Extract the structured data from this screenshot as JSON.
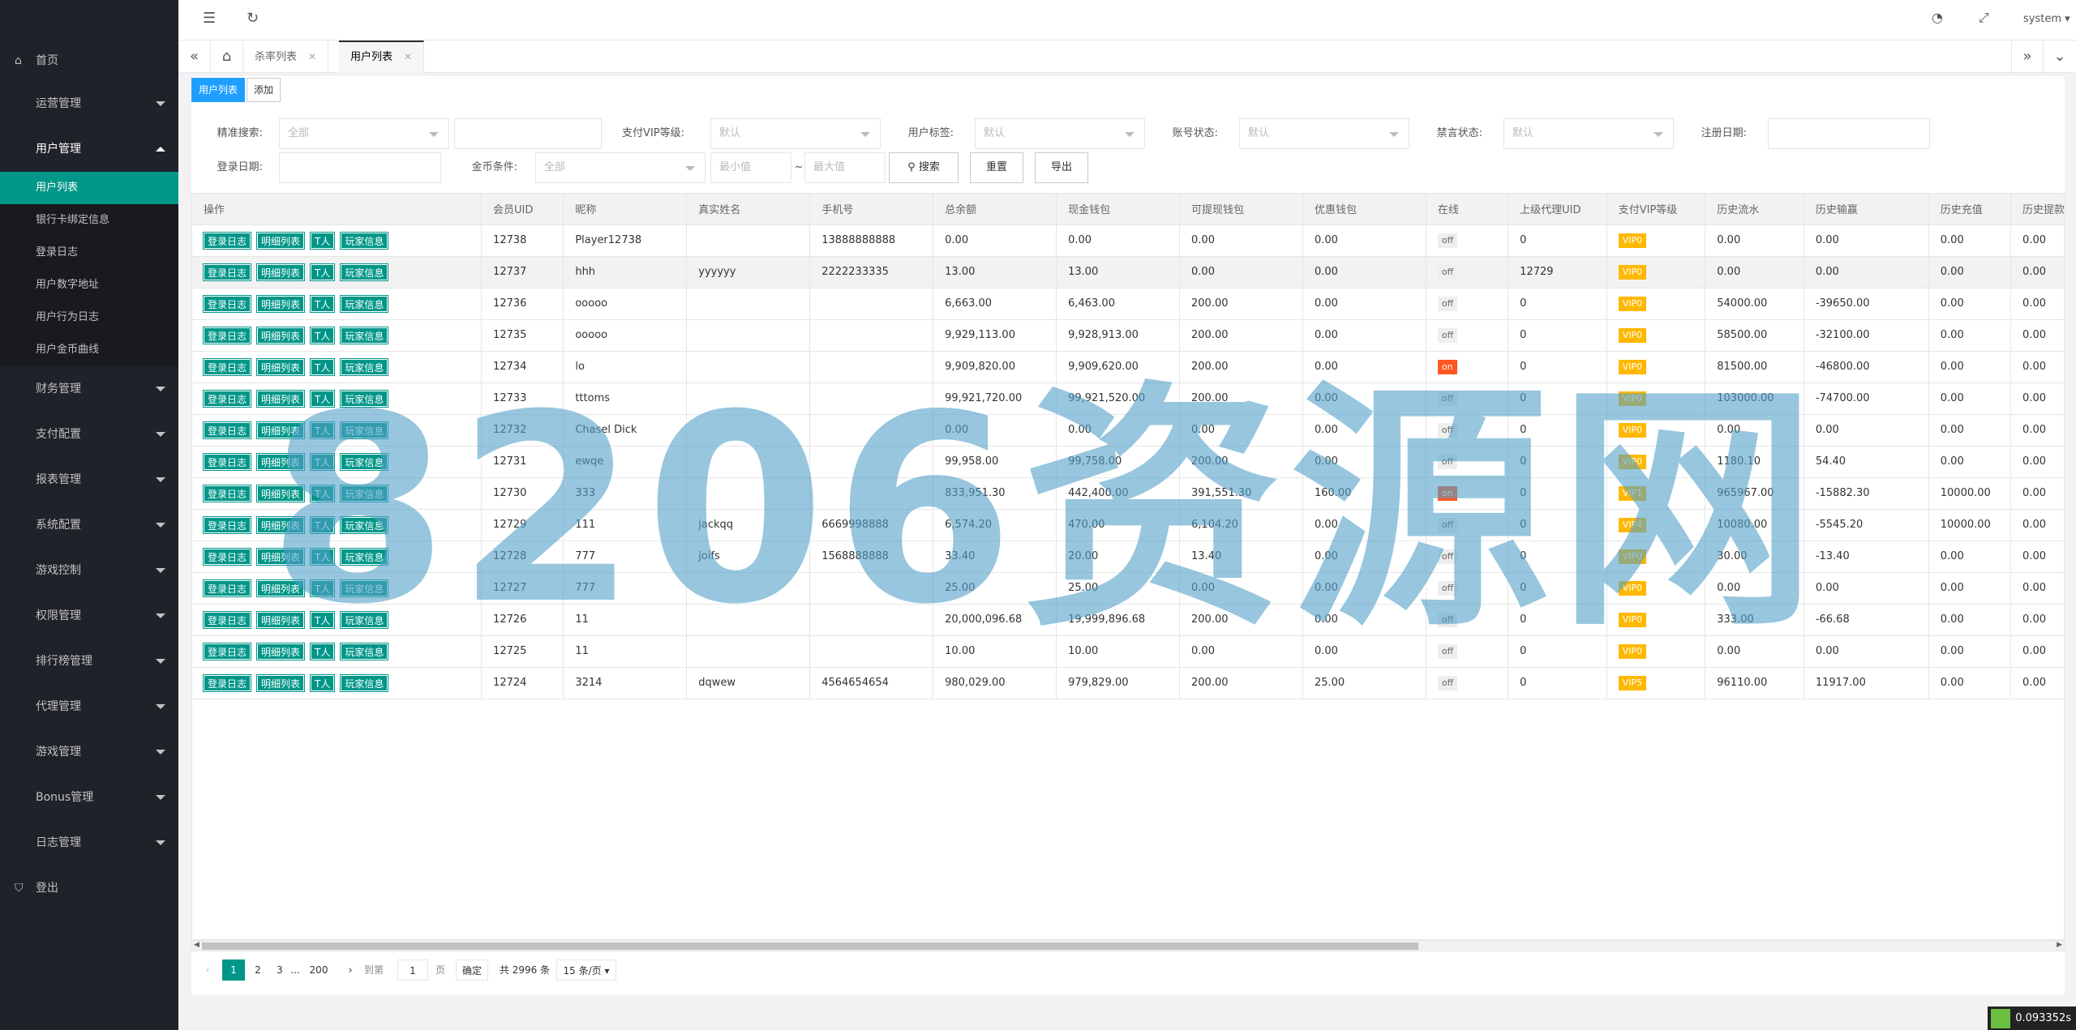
{
  "sidebar": {
    "home": "首页",
    "items": [
      {
        "label": "运营管理",
        "expanded": false
      },
      {
        "label": "用户管理",
        "expanded": true
      },
      {
        "label": "财务管理",
        "expanded": false
      },
      {
        "label": "支付配置",
        "expanded": false
      },
      {
        "label": "报表管理",
        "expanded": false
      },
      {
        "label": "系统配置",
        "expanded": false
      },
      {
        "label": "游戏控制",
        "expanded": false
      },
      {
        "label": "权限管理",
        "expanded": false
      },
      {
        "label": "排行榜管理",
        "expanded": false
      },
      {
        "label": "代理管理",
        "expanded": false
      },
      {
        "label": "游戏管理",
        "expanded": false
      },
      {
        "label": "Bonus管理",
        "expanded": false
      },
      {
        "label": "日志管理",
        "expanded": false
      }
    ],
    "subitems": [
      "用户列表",
      "银行卡绑定信息",
      "登录日志",
      "用户数字地址",
      "用户行为日志",
      "用户金币曲线"
    ],
    "logout": "登出"
  },
  "topbar": {
    "user": "system"
  },
  "tabs": [
    "杀率列表",
    "用户列表"
  ],
  "toolbar": {
    "list_btn": "用户列表",
    "add_btn": "添加"
  },
  "filters": {
    "exact_search_label": "精准搜索:",
    "exact_search_value": "全部",
    "vip_label": "支付VIP等级:",
    "vip_value": "默认",
    "tag_label": "用户标签:",
    "tag_value": "默认",
    "account_label": "账号状态:",
    "account_value": "默认",
    "mute_label": "禁言状态:",
    "mute_value": "默认",
    "reg_label": "注册日期:",
    "login_label": "登录日期:",
    "coin_label": "金币条件:",
    "coin_value": "全部",
    "min_placeholder": "最小值",
    "max_placeholder": "最大值",
    "tilde": "~",
    "search_btn": "搜索",
    "reset_btn": "重置",
    "export_btn": "导出"
  },
  "table": {
    "headers": [
      "操作",
      "会员UID",
      "昵称",
      "真实姓名",
      "手机号",
      "总余额",
      "现金钱包",
      "可提现钱包",
      "优惠钱包",
      "在线",
      "上级代理UID",
      "支付VIP等级",
      "历史流水",
      "历史输赢",
      "历史充值",
      "历史提款"
    ],
    "actions": [
      "登录日志",
      "明细列表",
      "T人",
      "玩家信息"
    ],
    "rows": [
      {
        "uid": "12738",
        "nick": "Player12738",
        "name": "",
        "phone": "13888888888",
        "total": "0.00",
        "cash": "0.00",
        "withdraw": "0.00",
        "promo": "0.00",
        "online": "off",
        "parent": "0",
        "vip": "VIP0",
        "flow": "0.00",
        "winloss": "0.00",
        "recharge": "0.00",
        "payout": "0.00"
      },
      {
        "uid": "12737",
        "nick": "hhh",
        "name": "yyyyyy",
        "phone": "2222233335",
        "total": "13.00",
        "cash": "13.00",
        "withdraw": "0.00",
        "promo": "0.00",
        "online": "off",
        "parent": "12729",
        "vip": "VIP0",
        "flow": "0.00",
        "winloss": "0.00",
        "recharge": "0.00",
        "payout": "0.00"
      },
      {
        "uid": "12736",
        "nick": "ooooo",
        "name": "",
        "phone": "",
        "total": "6,663.00",
        "cash": "6,463.00",
        "withdraw": "200.00",
        "promo": "0.00",
        "online": "off",
        "parent": "0",
        "vip": "VIP0",
        "flow": "54000.00",
        "winloss": "-39650.00",
        "recharge": "0.00",
        "payout": "0.00"
      },
      {
        "uid": "12735",
        "nick": "ooooo",
        "name": "",
        "phone": "",
        "total": "9,929,113.00",
        "cash": "9,928,913.00",
        "withdraw": "200.00",
        "promo": "0.00",
        "online": "off",
        "parent": "0",
        "vip": "VIP0",
        "flow": "58500.00",
        "winloss": "-32100.00",
        "recharge": "0.00",
        "payout": "0.00"
      },
      {
        "uid": "12734",
        "nick": "lo",
        "name": "",
        "phone": "",
        "total": "9,909,820.00",
        "cash": "9,909,620.00",
        "withdraw": "200.00",
        "promo": "0.00",
        "online": "on",
        "parent": "0",
        "vip": "VIP0",
        "flow": "81500.00",
        "winloss": "-46800.00",
        "recharge": "0.00",
        "payout": "0.00"
      },
      {
        "uid": "12733",
        "nick": "tttoms",
        "name": "",
        "phone": "",
        "total": "99,921,720.00",
        "cash": "99,921,520.00",
        "withdraw": "200.00",
        "promo": "0.00",
        "online": "off",
        "parent": "0",
        "vip": "VIP0",
        "flow": "103000.00",
        "winloss": "-74700.00",
        "recharge": "0.00",
        "payout": "0.00"
      },
      {
        "uid": "12732",
        "nick": "Chasel Dick",
        "name": "",
        "phone": "",
        "total": "0.00",
        "cash": "0.00",
        "withdraw": "0.00",
        "promo": "0.00",
        "online": "off",
        "parent": "0",
        "vip": "VIP0",
        "flow": "0.00",
        "winloss": "0.00",
        "recharge": "0.00",
        "payout": "0.00"
      },
      {
        "uid": "12731",
        "nick": "ewqe",
        "name": "",
        "phone": "",
        "total": "99,958.00",
        "cash": "99,758.00",
        "withdraw": "200.00",
        "promo": "0.00",
        "online": "off",
        "parent": "0",
        "vip": "VIP0",
        "flow": "1180.10",
        "winloss": "54.40",
        "recharge": "0.00",
        "payout": "0.00"
      },
      {
        "uid": "12730",
        "nick": "333",
        "name": "",
        "phone": "",
        "total": "833,951.30",
        "cash": "442,400.00",
        "withdraw": "391,551.30",
        "promo": "160.00",
        "online": "on",
        "parent": "0",
        "vip": "VIP1",
        "flow": "965967.00",
        "winloss": "-15882.30",
        "recharge": "10000.00",
        "payout": "0.00"
      },
      {
        "uid": "12729",
        "nick": "111",
        "name": "jackqq",
        "phone": "6669998888",
        "total": "6,574.20",
        "cash": "470.00",
        "withdraw": "6,104.20",
        "promo": "0.00",
        "online": "off",
        "parent": "0",
        "vip": "VIP4",
        "flow": "10080.00",
        "winloss": "-5545.20",
        "recharge": "10000.00",
        "payout": "0.00"
      },
      {
        "uid": "12728",
        "nick": "777",
        "name": "joifs",
        "phone": "1568888888",
        "total": "33.40",
        "cash": "20.00",
        "withdraw": "13.40",
        "promo": "0.00",
        "online": "off",
        "parent": "0",
        "vip": "VIP0",
        "flow": "30.00",
        "winloss": "-13.40",
        "recharge": "0.00",
        "payout": "0.00"
      },
      {
        "uid": "12727",
        "nick": "777",
        "name": "",
        "phone": "",
        "total": "25.00",
        "cash": "25.00",
        "withdraw": "0.00",
        "promo": "0.00",
        "online": "off",
        "parent": "0",
        "vip": "VIP0",
        "flow": "0.00",
        "winloss": "0.00",
        "recharge": "0.00",
        "payout": "0.00"
      },
      {
        "uid": "12726",
        "nick": "11",
        "name": "",
        "phone": "",
        "total": "20,000,096.68",
        "cash": "19,999,896.68",
        "withdraw": "200.00",
        "promo": "0.00",
        "online": "off",
        "parent": "0",
        "vip": "VIP0",
        "flow": "333.00",
        "winloss": "-66.68",
        "recharge": "0.00",
        "payout": "0.00"
      },
      {
        "uid": "12725",
        "nick": "11",
        "name": "",
        "phone": "",
        "total": "10.00",
        "cash": "10.00",
        "withdraw": "0.00",
        "promo": "0.00",
        "online": "off",
        "parent": "0",
        "vip": "VIP0",
        "flow": "0.00",
        "winloss": "0.00",
        "recharge": "0.00",
        "payout": "0.00"
      },
      {
        "uid": "12724",
        "nick": "3214",
        "name": "dqwew",
        "phone": "4564654654",
        "total": "980,029.00",
        "cash": "979,829.00",
        "withdraw": "200.00",
        "promo": "25.00",
        "online": "off",
        "parent": "0",
        "vip": "VIP5",
        "flow": "96110.00",
        "winloss": "11917.00",
        "recharge": "0.00",
        "payout": "0.00"
      }
    ]
  },
  "pager": {
    "pages": [
      "1",
      "2",
      "3",
      "...",
      "200"
    ],
    "goto_label": "到第",
    "goto_value": "1",
    "page_unit": "页",
    "confirm": "确定",
    "total": "共 2996 条",
    "page_size": "15 条/页"
  },
  "status": {
    "timer": "0.093352s"
  },
  "watermark": "8206资源网",
  "colors": {
    "sidebar_bg": "#20222a",
    "accent": "#009688",
    "primary": "#1e9fff",
    "vip": "#ffb800",
    "online": "#ff5722"
  }
}
